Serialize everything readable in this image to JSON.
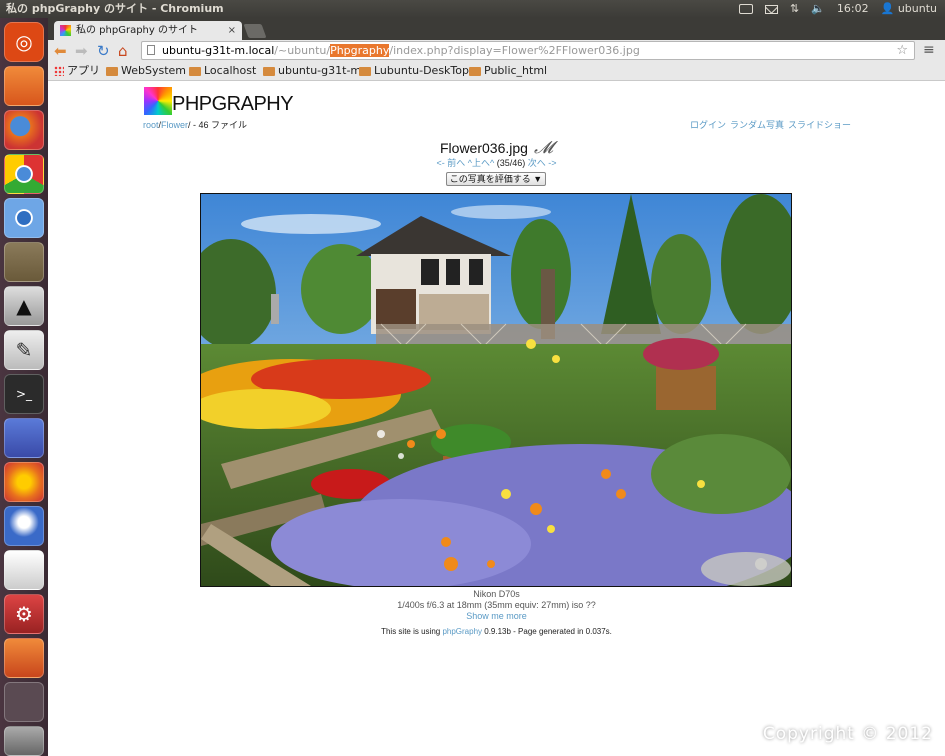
{
  "panel": {
    "title": "私の phpGraphy のサイト - Chromium",
    "clock": "16:02",
    "user": "ubuntu",
    "icons": [
      "keyboard-icon",
      "mail-icon",
      "network-icon",
      "volume-icon",
      "user-icon"
    ]
  },
  "launcher": {
    "items": [
      "ubuntu-dash-icon",
      "files-icon",
      "firefox-icon",
      "chrome-icon",
      "chromium-icon",
      "gimp-icon",
      "inkscape-icon",
      "text-editor-icon",
      "terminal-icon",
      "libreoffice-icon",
      "ubuntu-one-icon",
      "thunderbird-icon",
      "document-icon",
      "system-settings-icon",
      "software-center-icon",
      "workspace-switcher-icon",
      "trash-icon"
    ]
  },
  "browser": {
    "tab_title": "私の phpGraphy のサイト",
    "tab_close": "×",
    "url_host": "ubuntu-g31t-m.local",
    "url_path1": "/~ubuntu/",
    "url_highlight": "Phpgraphy",
    "url_path2": "/index.php?display=Flower%2FFlower036.jpg",
    "bookmarks": [
      "アプリ",
      "WebSystem",
      "Localhost",
      "ubuntu-g31t-m",
      "Lubuntu-DeskTop",
      "Public_html"
    ]
  },
  "site": {
    "logo_text": "PHPGRAPHY",
    "breadcrumb_root": "root",
    "breadcrumb_sep1": "/",
    "breadcrumb_folder": "Flower",
    "breadcrumb_rest": "/ - 46 ファイル",
    "link_login": "ログイン",
    "link_random": "ランダム写真",
    "link_slideshow": "スライドショー",
    "photo_title": "Flower036.jpg",
    "nav_prev": "<- 前へ",
    "nav_up": "^上へ^",
    "nav_count": "(35/46)",
    "nav_next": "次へ ->",
    "rate_select": "この写真を評価する ▼",
    "exif_camera": "Nikon D70s",
    "exif_settings": "1/400s f/6.3 at 18mm (35mm equiv: 27mm) iso ??",
    "exif_more": "Show me more",
    "footer_pre": "This site is using ",
    "footer_link": "phpGraphy",
    "footer_post": " 0.9.13b - Page generated in 0.037s.",
    "copyright": "Copyright © 2012"
  },
  "colors": {
    "link": "#5a9ac5",
    "launcher_bg": "#3a2a33",
    "panel_bg": "#3c3b37",
    "url_highlight": "#e9772d"
  }
}
